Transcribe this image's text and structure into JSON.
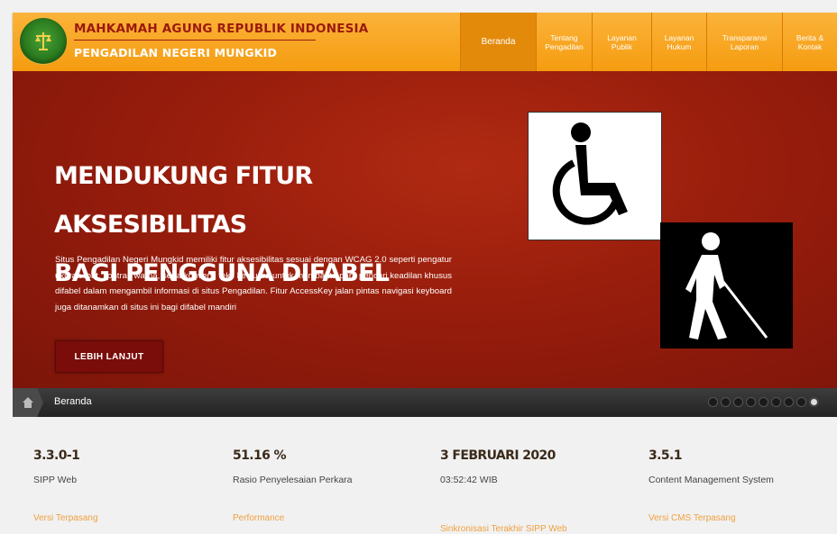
{
  "header": {
    "org_top": "MAHKAMAH AGUNG REPUBLIK INDONESIA",
    "org_bottom": "PENGADILAN NEGERI MUNGKID",
    "nav": [
      {
        "label": "Beranda",
        "active": true
      },
      {
        "label": "Tentang\nPengadilan",
        "active": false
      },
      {
        "label": "Layanan\nPublik",
        "active": false
      },
      {
        "label": "Layanan\nHukum",
        "active": false
      },
      {
        "label": "Transparansi\nLaporan",
        "active": false
      },
      {
        "label": "Berita &\nKontak",
        "active": false
      }
    ]
  },
  "hero": {
    "title_line1": "MENDUKUNG FITUR AKSESIBILITAS",
    "title_line2": "BAGI PENGGUNA DIFABEL",
    "text": "Situs Pengadilan Negeri Mungkid memiliki fitur aksesibilitas sesuai dengan WCAG 2.0 seperti pengatur ukuran font, kontras warna, serta konversi teks ke suara untuk membantu para pencari keadilan khusus difabel dalam mengambil informasi di situs Pengadilan. Fitur AccessKey jalan pintas navigasi keyboard juga ditanamkan di situs ini bagi difabel mandiri",
    "button": "LEBIH LANJUT",
    "icon1": "wheelchair-icon",
    "icon2": "blind-person-icon"
  },
  "breadcrumb": {
    "label": "Beranda",
    "slides_total": 9,
    "slide_active": 9
  },
  "stats": [
    {
      "value": "3.3.0-1",
      "sub": "SIPP Web",
      "link": "Versi Terpasang"
    },
    {
      "value": "51.16 %",
      "sub": "Rasio Penyelesaian Perkara",
      "link": "Performance"
    },
    {
      "value": "3 FEBRUARI 2020",
      "sub": "03:52:42 WIB",
      "link": "Sinkronisasi Terakhir SIPP Web"
    },
    {
      "value": "3.5.1",
      "sub": "Content Management System",
      "link": "Versi CMS Terpasang"
    }
  ],
  "colors": {
    "header_orange": "#f59c10",
    "hero_red": "#981d0c",
    "title_red": "#9b1a10",
    "link_orange": "#f0a040"
  }
}
